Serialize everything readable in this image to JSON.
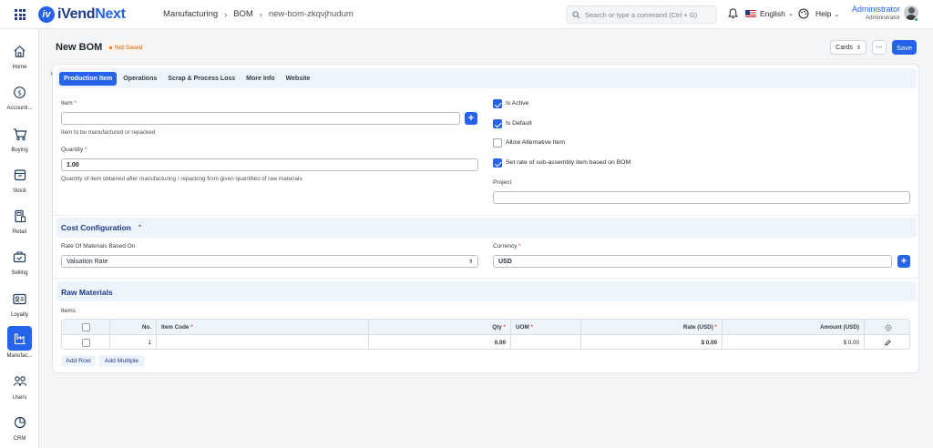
{
  "app": {
    "brand_left": "iVend",
    "brand_right": "Next",
    "logo_letter": "iv"
  },
  "breadcrumb": [
    "Manufacturing",
    "BOM",
    "new-bom-zkqvjhudum"
  ],
  "search": {
    "placeholder": "Search or type a command (Ctrl + G)"
  },
  "navbar": {
    "language": "English",
    "help": "Help",
    "user_name": "Administrator",
    "user_role": "Administrator"
  },
  "sidebar": {
    "items": [
      {
        "label": "Home",
        "icon": "home-icon"
      },
      {
        "label": "Accounti...",
        "icon": "dollar-icon"
      },
      {
        "label": "Buying",
        "icon": "cart-icon"
      },
      {
        "label": "Stock",
        "icon": "box-icon"
      },
      {
        "label": "Retail",
        "icon": "retail-icon"
      },
      {
        "label": "Selling",
        "icon": "selling-icon"
      },
      {
        "label": "Loyalty",
        "icon": "loyalty-icon"
      },
      {
        "label": "Manufac...",
        "icon": "factory-icon"
      },
      {
        "label": "Users",
        "icon": "users-icon"
      },
      {
        "label": "CRM",
        "icon": "crm-icon"
      }
    ],
    "active_index": 7
  },
  "page": {
    "title": "New BOM",
    "status": "Not Saved",
    "cards_label": "Cards",
    "more_label": "···",
    "save_label": "Save"
  },
  "tabs": [
    "Production Item",
    "Operations",
    "Scrap & Process Loss",
    "More Info",
    "Website"
  ],
  "form": {
    "item_label": "Item",
    "item_value": "",
    "item_help": "Item to be manufactured or repacked",
    "quantity_label": "Quantity",
    "quantity_value": "1.00",
    "quantity_help": "Quantity of item obtained after manufacturing / repacking from given quantities of raw materials",
    "project_label": "Project",
    "project_value": "",
    "checks": [
      {
        "label": "Is Active",
        "checked": true
      },
      {
        "label": "Is Default",
        "checked": true
      },
      {
        "label": "Allow Alternative Item",
        "checked": false
      },
      {
        "label": "Set rate of sub-assembly item based on BOM",
        "checked": true
      }
    ],
    "required_mark": "*"
  },
  "cost": {
    "title": "Cost Configuration",
    "rate_label": "Rate Of Materials Based On",
    "rate_value": "Valuation Rate",
    "currency_label": "Currency",
    "currency_value": "USD"
  },
  "raw": {
    "title": "Raw Materials",
    "items_label": "Items",
    "columns": [
      "No.",
      "Item Code",
      "Qty",
      "UOM",
      "Rate (USD)",
      "Amount (USD)"
    ],
    "row": {
      "no": "1",
      "item_code": "",
      "qty": "0.00",
      "uom": "",
      "rate": "$ 0.00",
      "amount": "$ 0.00"
    },
    "add_row": "Add Row",
    "add_multiple": "Add Multiple"
  }
}
